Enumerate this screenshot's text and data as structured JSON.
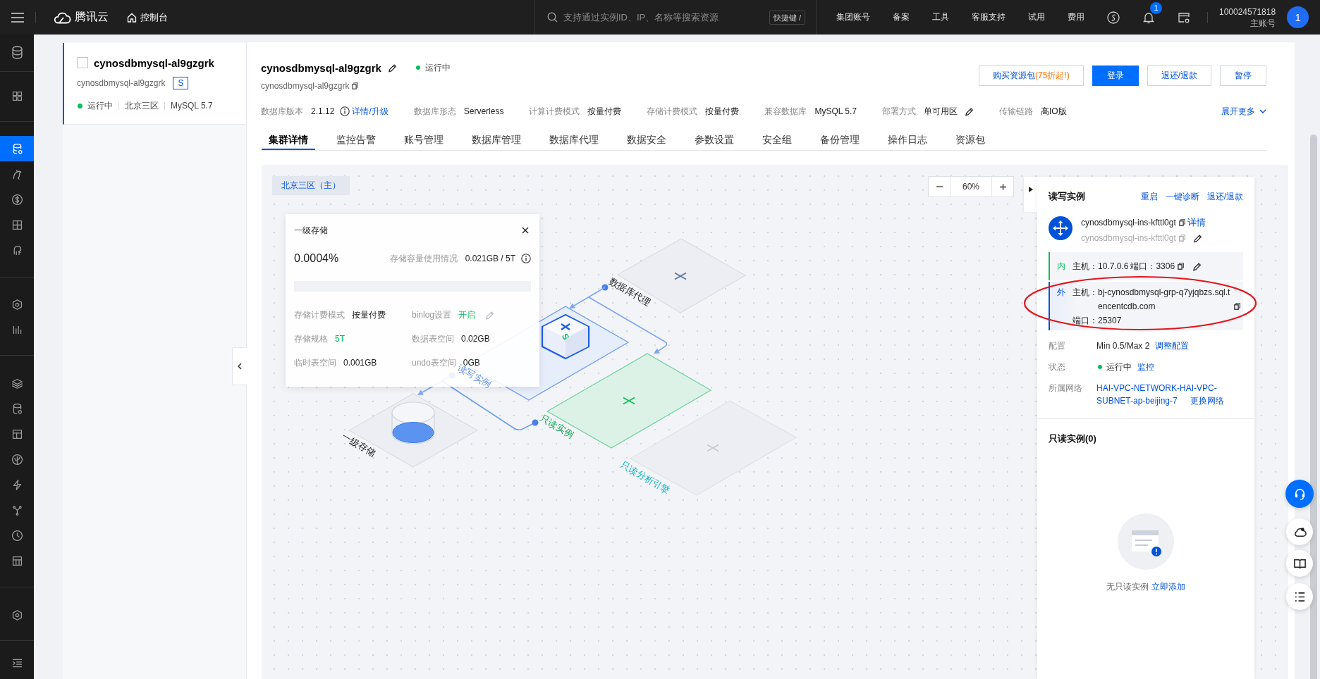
{
  "topbar": {
    "brand": "腾讯云",
    "console": "控制台",
    "search": {
      "placeholder": "支持通过实例ID、IP、名称等搜索资源",
      "shortcut": "快捷键 /"
    },
    "nav": [
      "集团账号",
      "备案",
      "工具",
      "客服支持",
      "试用",
      "费用"
    ],
    "notification_count": "1",
    "account": {
      "id": "100024571818",
      "role": "主账号",
      "avatar": "1"
    }
  },
  "sidebar": {
    "items": [
      {
        "selected": false
      },
      {
        "selected": false
      },
      {
        "selected": true
      },
      {
        "selected": false
      },
      {
        "selected": false
      },
      {
        "selected": false
      },
      {
        "selected": false
      },
      {
        "selected": false
      },
      {
        "selected": false
      },
      {
        "selected": false
      },
      {
        "selected": false
      },
      {
        "selected": false
      },
      {
        "selected": false
      },
      {
        "selected": false
      },
      {
        "selected": false
      },
      {
        "selected": false
      },
      {
        "selected": false
      },
      {
        "selected": false
      },
      {
        "selected": false
      }
    ]
  },
  "instance_list": [
    {
      "name": "cynosdbmysql-al9gzgrk",
      "checked": false,
      "selected": true,
      "id": "cynosdbmysql-al9gzgrk",
      "badge": "S",
      "status": "运行中",
      "region": "北京三区",
      "engine": "MySQL 5.7"
    }
  ],
  "instance": {
    "name": "cynosdbmysql-al9gzgrk",
    "status": "运行中",
    "id": "cynosdbmysql-al9gzgrk"
  },
  "actions": [
    {
      "kind": "promo",
      "label": "购买资源包",
      "promo": "(75折起!)"
    },
    {
      "kind": "primary",
      "label": "登录"
    },
    {
      "kind": "default",
      "label": "退还/退款"
    },
    {
      "kind": "default",
      "label": "暂停"
    }
  ],
  "specs": [
    {
      "kind": "version",
      "label": "数据库版本",
      "value": "2.1.12",
      "link": "详情/升级"
    },
    {
      "kind": "plain",
      "label": "数据库形态",
      "value": "Serverless"
    },
    {
      "kind": "plain",
      "label": "计算计费模式",
      "value": "按量付费"
    },
    {
      "kind": "plain",
      "label": "存储计费模式",
      "value": "按量付费"
    },
    {
      "kind": "plain",
      "label": "兼容数据库",
      "value": "MySQL 5.7"
    },
    {
      "kind": "editable",
      "label": "部署方式",
      "value": "单可用区"
    },
    {
      "kind": "plain",
      "label": "传输链路",
      "value": "高IO版"
    }
  ],
  "expand": "展开更多",
  "tabs": [
    {
      "label": "集群详情",
      "selected": true
    },
    {
      "label": "监控告警",
      "selected": false
    },
    {
      "label": "账号管理",
      "selected": false
    },
    {
      "label": "数据库管理",
      "selected": false
    },
    {
      "label": "数据库代理",
      "selected": false
    },
    {
      "label": "数据安全",
      "selected": false
    },
    {
      "label": "参数设置",
      "selected": false
    },
    {
      "label": "安全组",
      "selected": false
    },
    {
      "label": "备份管理",
      "selected": false
    },
    {
      "label": "操作日志",
      "selected": false
    },
    {
      "label": "资源包",
      "selected": false
    }
  ],
  "diagram": {
    "region": "北京三区（主）",
    "zoom": "60%",
    "nodes": [
      {
        "kind": "proxy",
        "label": "数据库代理"
      },
      {
        "kind": "rw",
        "label": "读写实例",
        "badge": "S"
      },
      {
        "kind": "ro",
        "label": "只读实例"
      },
      {
        "kind": "analytic",
        "label": "只读分析引擎"
      },
      {
        "kind": "storage",
        "label": "一级存储"
      }
    ]
  },
  "storage_popup": {
    "title": "一级存储",
    "percent": "0.0004%",
    "usage_label": "存储容量使用情况",
    "usage": "0.021GB / 5T",
    "items": [
      {
        "kind": "plain",
        "label": "存储计费模式",
        "value": "按量付费"
      },
      {
        "kind": "switch",
        "label": "binlog设置",
        "value": "开启"
      },
      {
        "kind": "accent",
        "label": "存储规格",
        "value": "5T"
      },
      {
        "kind": "plain",
        "label": "数据表空间",
        "value": "0.02GB"
      },
      {
        "kind": "plain",
        "label": "临时表空间",
        "value": "0.001GB"
      },
      {
        "kind": "plain",
        "label": "undo表空间",
        "value": "0GB"
      }
    ]
  },
  "rw_panel": {
    "title": "读写实例",
    "actions": [
      "重启",
      "一键诊断",
      "退还/退款"
    ],
    "instance_id": "cynosdbmysql-ins-kfttl0gt",
    "detail_link": "详情",
    "instance_name": "cynosdbmysql-ins-kfttl0gt",
    "endpoints": [
      {
        "kind": "private",
        "tag": "内",
        "host_label": "主机：",
        "host": "10.7.0.6",
        "port_label": "端口：",
        "port": "3306",
        "highlighted": false
      },
      {
        "kind": "public",
        "tag": "外",
        "host_label": "主机：",
        "host": "bj-cynosdbmysql-grp-q7yjqbzs.sql.tencentcdb.com",
        "port_label": "端口：",
        "port": "25307",
        "highlighted": true
      }
    ],
    "fields": [
      {
        "kind": "config",
        "label": "配置",
        "value": "Min 0.5/Max 2",
        "link": "调整配置"
      },
      {
        "kind": "status",
        "label": "状态",
        "value": "运行中",
        "link": "监控"
      },
      {
        "kind": "network",
        "label": "所属网络",
        "value": "HAI-VPC-NETWORK-HAI-VPC-SUBNET-ap-beijing-7",
        "link": "更换网络"
      }
    ]
  },
  "ro_panel": {
    "title": "只读实例(0)",
    "empty": "无只读实例",
    "add_link": "立即添加"
  }
}
